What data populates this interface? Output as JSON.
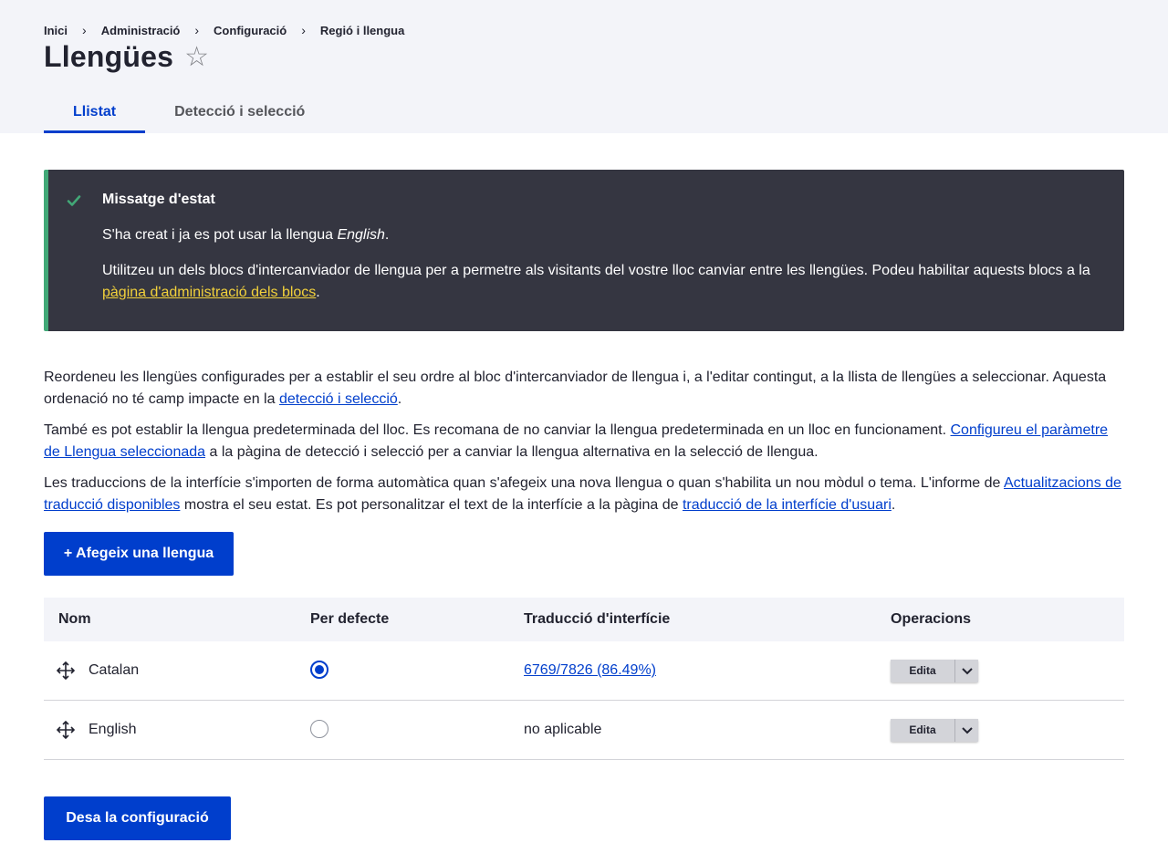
{
  "breadcrumb": [
    {
      "label": "Inici"
    },
    {
      "label": "Administració"
    },
    {
      "label": "Configuració"
    },
    {
      "label": "Regió i llengua"
    }
  ],
  "page": {
    "title": "Llengües",
    "star": "☆"
  },
  "tabs": [
    {
      "label": "Llistat",
      "active": true
    },
    {
      "label": "Detecció i selecció",
      "active": false
    }
  ],
  "status": {
    "title": "Missatge d'estat",
    "line1_prefix": "S'ha creat i ja es pot usar la llengua ",
    "line1_em": "English",
    "line1_suffix": ".",
    "line2_text": "Utilitzeu un dels blocs d'intercanviador de llengua per a permetre als visitants del vostre lloc canviar entre les llengües. Podeu habilitar aquests blocs a la ",
    "line2_link": "pàgina d'administració dels blocs",
    "line2_suffix": ".",
    "accent_color": "#42a877"
  },
  "intro": {
    "p1_text": "Reordeneu les llengües configurades per a establir el seu ordre al bloc d'intercanviador de llengua i, a l'editar contingut, a la llista de llengües a seleccionar. Aquesta ordenació no té camp impacte en la ",
    "p1_link": "detecció i selecció",
    "p1_suffix": ".",
    "p2_text": "També es pot establir la llengua predeterminada del lloc. Es recomana de no canviar la llengua predeterminada en un lloc en funcionament. ",
    "p2_link": "Configureu el paràmetre de Llengua seleccionada",
    "p2_suffix": " a la pàgina de detecció i selecció per a canviar la llengua alternativa en la selecció de llengua.",
    "p3_text": "Les traduccions de la interfície s'importen de forma automàtica quan s'afegeix una nova llengua o quan s'habilita un nou mòdul o tema. L'informe de ",
    "p3_link1": "Actualitzacions de traducció disponibles",
    "p3_mid": " mostra el seu estat. Es pot personalitzar el text de la interfície a la pàgina de ",
    "p3_link2": "traducció de la interfície d'usuari",
    "p3_suffix": "."
  },
  "add_button": "+ Afegeix una llengua",
  "table": {
    "headers": {
      "name": "Nom",
      "default": "Per defecte",
      "translation": "Traducció d'interfície",
      "operations": "Operacions"
    },
    "rows": [
      {
        "name": "Catalan",
        "is_default": true,
        "translation": "6769/7826 (86.49%)",
        "translation_is_link": true,
        "edit": "Edita"
      },
      {
        "name": "English",
        "is_default": false,
        "translation": "no aplicable",
        "translation_is_link": false,
        "edit": "Edita"
      }
    ]
  },
  "save_button": "Desa la configuració",
  "colors": {
    "primary": "#003ecc",
    "header_bg": "#f3f4f9",
    "status_bg": "#353641",
    "status_link": "#f2d13b"
  }
}
